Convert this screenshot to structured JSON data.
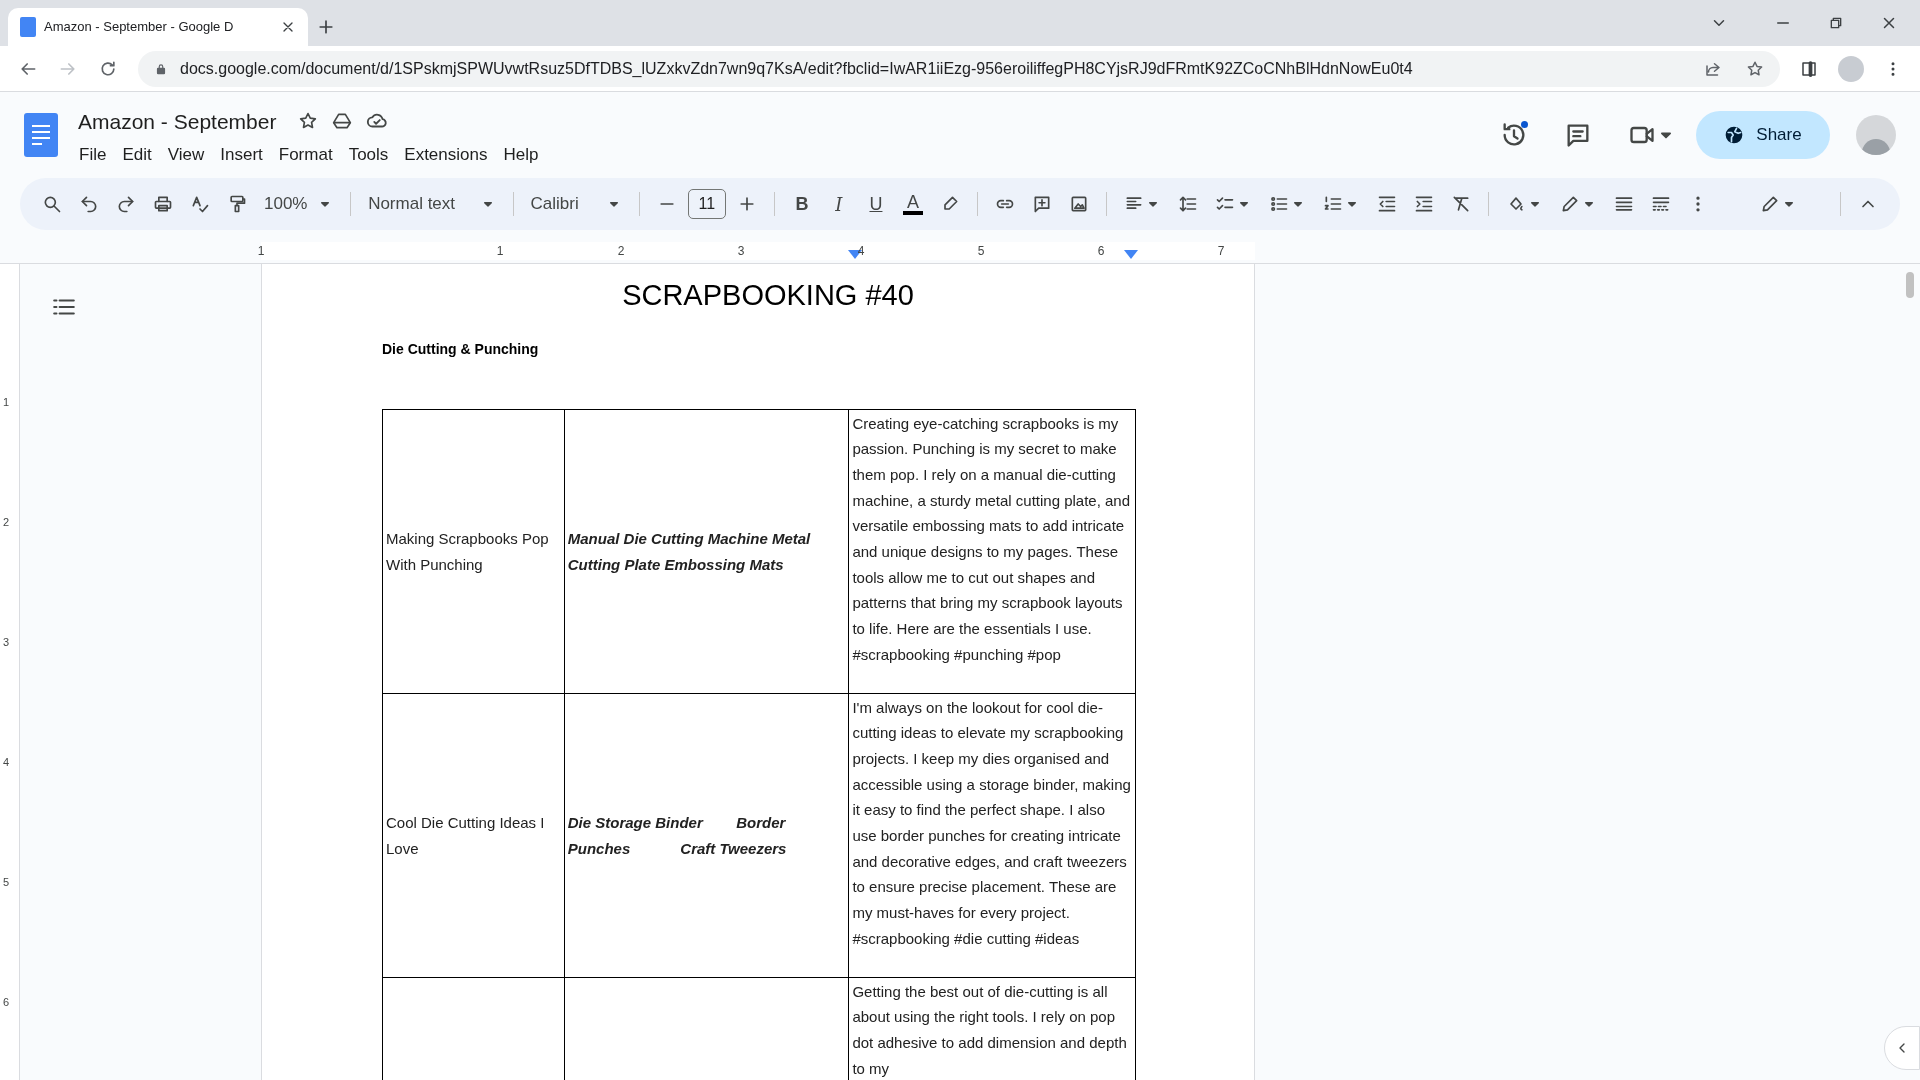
{
  "browser": {
    "tab_title": "Amazon - September - Google D",
    "url": "docs.google.com/document/d/1SPskmjSPWUvwtRsuz5DfTDBS_lUZxkvZdn7wn9q7KsA/edit?fbclid=IwAR1iiEzg-956eroiliffegPH8CYjsRJ9dFRmtK92ZCoCNhBlHdnNowEu0t4"
  },
  "document": {
    "title": "Amazon - September",
    "menu": [
      "File",
      "Edit",
      "View",
      "Insert",
      "Format",
      "Tools",
      "Extensions",
      "Help"
    ],
    "share_label": "Share"
  },
  "toolbar": {
    "zoom": "100%",
    "style": "Normal text",
    "font": "Calibri",
    "font_size": "11",
    "format_letters": [
      "B",
      "I",
      "U",
      "A"
    ]
  },
  "ruler": {
    "horizontal": [
      "1",
      "1",
      "2",
      "3",
      "4",
      "5",
      "6",
      "7"
    ],
    "vertical": [
      "1",
      "2",
      "3",
      "4",
      "5",
      "6"
    ]
  },
  "page": {
    "heading": "SCRAPBOOKING #40",
    "subheading": "Die Cutting & Punching",
    "rows": [
      {
        "topic": "Making Scrapbooks Pop With Punching",
        "products": "Manual Die Cutting Machine Metal Cutting Plate Embossing Mats",
        "description": "Creating eye-catching scrapbooks is my passion. Punching is my secret to make them pop. I rely on a manual die-cutting machine, a sturdy metal cutting plate, and versatile embossing mats to add intricate and unique designs to my pages. These tools allow me to cut out shapes and patterns that bring my scrapbook layouts to life. Here are the essentials I use. #scrapbooking #punching #pop"
      },
      {
        "topic": "Cool Die Cutting Ideas I Love",
        "products": "Die Storage Binder        Border Punches            Craft Tweezers",
        "description": "I'm always on the lookout for cool die-cutting ideas to elevate my scrapbooking projects. I keep my dies organised and accessible using a storage binder, making it easy to find the perfect shape. I also use border punches for creating intricate and decorative edges, and craft tweezers to ensure precise placement. These are my must-haves for every project. #scrapbooking #die cutting #ideas"
      },
      {
        "topic": "",
        "products": "",
        "description": "Getting the best out of die-cutting is all about using the right tools. I rely on pop dot adhesive to add dimension and depth to my"
      }
    ]
  }
}
